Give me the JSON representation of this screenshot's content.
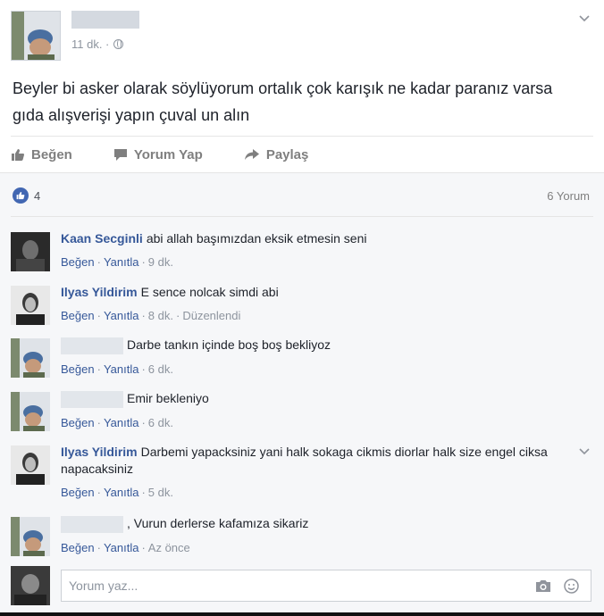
{
  "post": {
    "timestamp": "11 dk. · ",
    "text": "Beyler bi asker olarak söylüyorum ortalık çok karışık ne kadar paranız varsa gıda alışverişi yapın çuval un alın",
    "actions": {
      "like": "Beğen",
      "comment": "Yorum Yap",
      "share": "Paylaş"
    }
  },
  "reactions": {
    "count": "4",
    "comment_count": "6 Yorum"
  },
  "comments": [
    {
      "author": "Kaan Secginli",
      "text": "abi allah başımızdan eksik etmesin seni",
      "like": "Beğen",
      "reply": "Yanıtla",
      "time": "9 dk."
    },
    {
      "author": "Ilyas Yildirim",
      "text": "E sence nolcak simdi abi",
      "like": "Beğen",
      "reply": "Yanıtla",
      "time": "8 dk.",
      "edited": "Düzenlendi"
    },
    {
      "author": "",
      "text": "Darbe tankın içinde boş boş bekliyoz",
      "like": "Beğen",
      "reply": "Yanıtla",
      "time": "6 dk."
    },
    {
      "author": "",
      "text": "Emir bekleniyo",
      "like": "Beğen",
      "reply": "Yanıtla",
      "time": "6 dk."
    },
    {
      "author": "Ilyas Yildirim",
      "text": "Darbemi yapacksiniz yani halk sokaga cikmis diorlar halk size engel ciksa napacaksiniz",
      "like": "Beğen",
      "reply": "Yanıtla",
      "time": "5 dk."
    },
    {
      "author": "",
      "text": ", Vurun derlerse kafamıza sikariz",
      "like": "Beğen",
      "reply": "Yanıtla",
      "time": "Az önce"
    }
  ],
  "composer": {
    "placeholder": "Yorum yaz..."
  },
  "icons": {
    "like": "thumbs-up-icon",
    "comment": "speech-bubble-icon",
    "share": "share-arrow-icon",
    "camera": "camera-icon",
    "emoji": "emoji-icon",
    "globe": "globe-icon",
    "chevron": "chevron-down-icon"
  },
  "colors": {
    "link": "#365899",
    "like_badge": "#4267b2",
    "meta": "#8d949e"
  }
}
